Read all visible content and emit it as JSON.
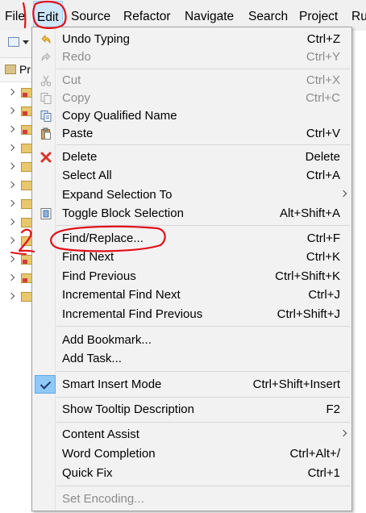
{
  "menubar": {
    "items": [
      {
        "label": "File"
      },
      {
        "label": "Edit"
      },
      {
        "label": "Source"
      },
      {
        "label": "Refactor"
      },
      {
        "label": "Navigate"
      },
      {
        "label": "Search"
      },
      {
        "label": "Project"
      },
      {
        "label": "Ru"
      }
    ]
  },
  "package_explorer": {
    "tab_label": "Pr"
  },
  "edit_menu": {
    "items": [
      {
        "label": "Undo Typing",
        "shortcut": "Ctrl+Z",
        "enabled": true,
        "icon": "undo-icon"
      },
      {
        "label": "Redo",
        "shortcut": "Ctrl+Y",
        "enabled": false,
        "icon": "redo-icon"
      },
      {
        "label": "Cut",
        "shortcut": "Ctrl+X",
        "enabled": false,
        "icon": "cut-icon"
      },
      {
        "label": "Copy",
        "shortcut": "Ctrl+C",
        "enabled": false,
        "icon": "copy-icon"
      },
      {
        "label": "Copy Qualified Name",
        "shortcut": "",
        "enabled": true,
        "icon": "copy-qualified-name-icon"
      },
      {
        "label": "Paste",
        "shortcut": "Ctrl+V",
        "enabled": true,
        "icon": "paste-icon"
      },
      {
        "label": "Delete",
        "shortcut": "Delete",
        "enabled": true,
        "icon": "delete-icon"
      },
      {
        "label": "Select All",
        "shortcut": "Ctrl+A",
        "enabled": true
      },
      {
        "label": "Expand Selection To",
        "shortcut": "",
        "enabled": true,
        "submenu": true
      },
      {
        "label": "Toggle Block Selection",
        "shortcut": "Alt+Shift+A",
        "enabled": true,
        "icon": "block-selection-icon"
      },
      {
        "label": "Find/Replace...",
        "shortcut": "Ctrl+F",
        "enabled": true
      },
      {
        "label": "Find Next",
        "shortcut": "Ctrl+K",
        "enabled": true
      },
      {
        "label": "Find Previous",
        "shortcut": "Ctrl+Shift+K",
        "enabled": true
      },
      {
        "label": "Incremental Find Next",
        "shortcut": "Ctrl+J",
        "enabled": true
      },
      {
        "label": "Incremental Find Previous",
        "shortcut": "Ctrl+Shift+J",
        "enabled": true
      },
      {
        "label": "Add Bookmark...",
        "shortcut": "",
        "enabled": true
      },
      {
        "label": "Add Task...",
        "shortcut": "",
        "enabled": true
      },
      {
        "label": "Smart Insert Mode",
        "shortcut": "Ctrl+Shift+Insert",
        "enabled": true,
        "checked": true
      },
      {
        "label": "Show Tooltip Description",
        "shortcut": "F2",
        "enabled": true
      },
      {
        "label": "Content Assist",
        "shortcut": "",
        "enabled": true,
        "submenu": true
      },
      {
        "label": "Word Completion",
        "shortcut": "Ctrl+Alt+/",
        "enabled": true
      },
      {
        "label": "Quick Fix",
        "shortcut": "Ctrl+1",
        "enabled": true
      },
      {
        "label": "Set Encoding...",
        "shortcut": "",
        "enabled": false
      }
    ]
  },
  "colors": {
    "annotation": "#e0101a",
    "menubar_active_bg": "#cde8ff",
    "checked_bg": "#90c8f6",
    "disabled_text": "#8c8c8c"
  }
}
